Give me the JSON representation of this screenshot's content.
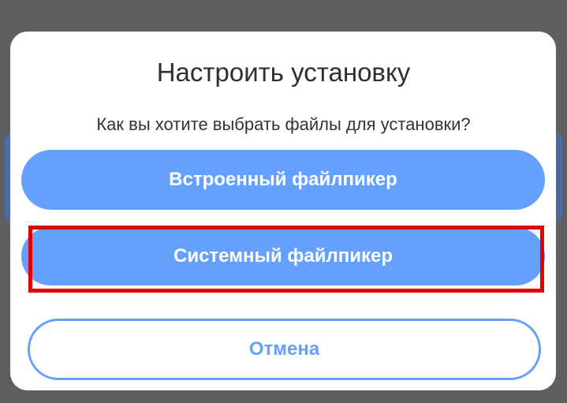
{
  "dialog": {
    "title": "Настроить установку",
    "subtitle": "Как вы хотите выбрать файлы для установки?",
    "builtin_button": "Встроенный файлпикер",
    "system_button": "Системный файлпикер",
    "cancel_button": "Отмена"
  },
  "colors": {
    "accent": "#64a0ff",
    "highlight": "#e00000",
    "overlay": "#5f5f5f"
  }
}
